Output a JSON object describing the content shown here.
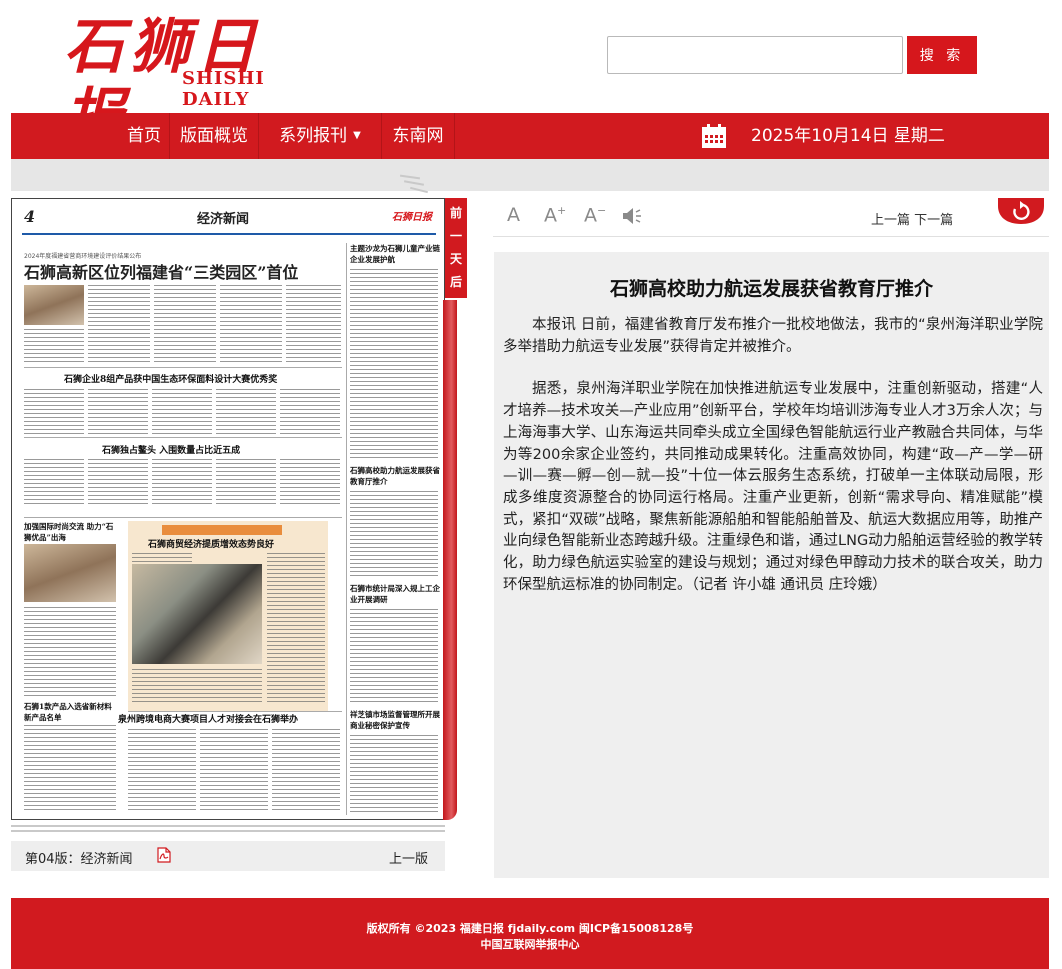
{
  "header": {
    "logo_cn": "石狮日报",
    "logo_en": "SHISHI DAILY",
    "search_placeholder": "",
    "search_button": "搜 索"
  },
  "nav": {
    "items": [
      "首页",
      "版面概览",
      "系列报刊",
      "东南网"
    ],
    "date": "2025年10月14日 星期二"
  },
  "paper": {
    "page_no": "4",
    "section": "经济新闻",
    "masthead": "石狮日报",
    "subhead": "2024年度福建省营商环境建设评价结果公布",
    "headline": "石狮高新区位列福建省“三类园区”首位",
    "headlines": [
      "石狮企业8组产品获中国生态环保面料设计大赛优秀奖",
      "石狮独占鳌头 入围数量占比近五成",
      "石狮商贸经济提质增效态势良好",
      "泉州跨境电商大赛项目人才对接会在石狮举办"
    ],
    "side_heads": [
      "主题沙龙为石狮儿童产业链企业发展护航",
      "石狮高校助力航运发展获省教育厅推介",
      "石狮市统计局深入规上工企业开展调研",
      "祥芝镇市场监督管理所开展商业秘密保护宣传",
      "加强国际时尚交流 助力“石狮优品”出海",
      "石狮1款产品入选省新材料新产品名单"
    ],
    "side_tab": "前一天 后一天",
    "footer_label": "第04版：经济新闻",
    "prev_page": "上一版"
  },
  "toolbar": {
    "font_normal": "A",
    "font_larger": "A",
    "font_smaller": "A",
    "prev_next": "上一篇 下一篇"
  },
  "article": {
    "title": "石狮高校助力航运发展获省教育厅推介",
    "paragraphs": [
      "本报讯 日前，福建省教育厅发布推介一批校地做法，我市的“泉州海洋职业学院多举措助力航运专业发展”获得肯定并被推介。",
      "据悉，泉州海洋职业学院在加快推进航运专业发展中，注重创新驱动，搭建“人才培养—技术攻关—产业应用”创新平台，学校年均培训涉海专业人才3万余人次；与上海海事大学、山东海运共同牵头成立全国绿色智能航运行业产教融合共同体，与华为等200余家企业签约，共同推动成果转化。注重高效协同，构建“政—产—学—研—训—赛—孵—创—就—投”十位一体云服务生态系统，打破单一主体联动局限，形成多维度资源整合的协同运行格局。注重产业更新，创新“需求导向、精准赋能”模式，紧扣“双碳”战略，聚焦新能源船舶和智能船舶普及、航运大数据应用等，助推产业向绿色智能新业态跨越升级。注重绿色和谐，通过LNG动力船舶运营经验的教学转化，助力绿色航运实验室的建设与规划；通过对绿色甲醇动力技术的联合攻关，助力环保型航运标准的协同制定。（记者 许小雄 通讯员 庄玲娥）"
    ]
  },
  "footer": {
    "line1": "版权所有 ©2023 福建日报 fjdaily.com 闽ICP备15008128号",
    "line2": "中国互联网举报中心"
  },
  "colors": {
    "brand_red": "#d11a1f",
    "nav_blue_rule": "#1e5aa8"
  }
}
